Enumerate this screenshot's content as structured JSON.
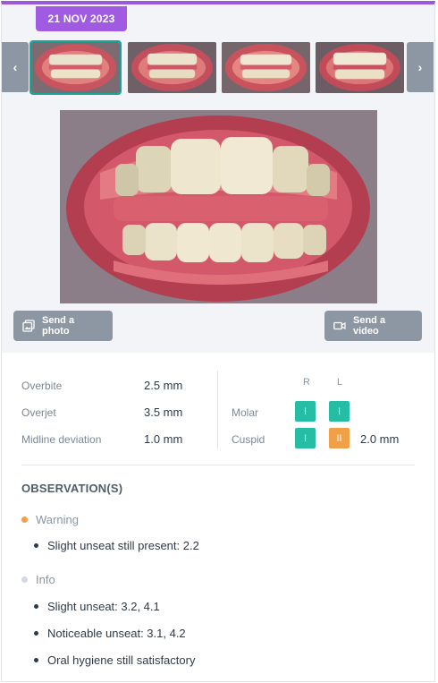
{
  "date_badge": "21 NOV 2023",
  "carousel": {
    "prev_icon": "chevron-left-icon",
    "next_icon": "chevron-right-icon",
    "prev_glyph": "‹",
    "next_glyph": "›",
    "thumbnails": [
      {
        "view": "front",
        "selected": true
      },
      {
        "view": "front",
        "selected": false
      },
      {
        "view": "front",
        "selected": false
      },
      {
        "view": "front",
        "selected": false
      }
    ]
  },
  "actions": {
    "send_photo": "Send a photo",
    "send_video": "Send a video",
    "photo_icon": "photos-icon",
    "video_icon": "video-camera-icon"
  },
  "measurements": [
    {
      "label": "Overbite",
      "value": "2.5 mm"
    },
    {
      "label": "Overjet",
      "value": "3.5 mm"
    },
    {
      "label": "Midline deviation",
      "value": "1.0 mm"
    }
  ],
  "classification": {
    "col_right": "R",
    "col_left": "L",
    "rows": [
      {
        "label": "Molar",
        "right": "I",
        "left": "I",
        "extra": ""
      },
      {
        "label": "Cuspid",
        "right": "I",
        "left": "II",
        "extra": "2.0 mm"
      }
    ]
  },
  "observations": {
    "title": "OBSERVATION(S)",
    "warning_label": "Warning",
    "warning_items": [
      "Slight unseat still present: 2.2"
    ],
    "info_label": "Info",
    "info_items": [
      "Slight unseat: 3.2, 4.1",
      "Noticeable unseat: 3.1, 4.2",
      "Oral hygiene still satisfactory"
    ]
  },
  "colors": {
    "accent": "#a15be3",
    "selected_border": "#1aa59a",
    "class_one": "#25bda4",
    "class_two": "#f0a148",
    "button_grey": "#8d97a3"
  }
}
